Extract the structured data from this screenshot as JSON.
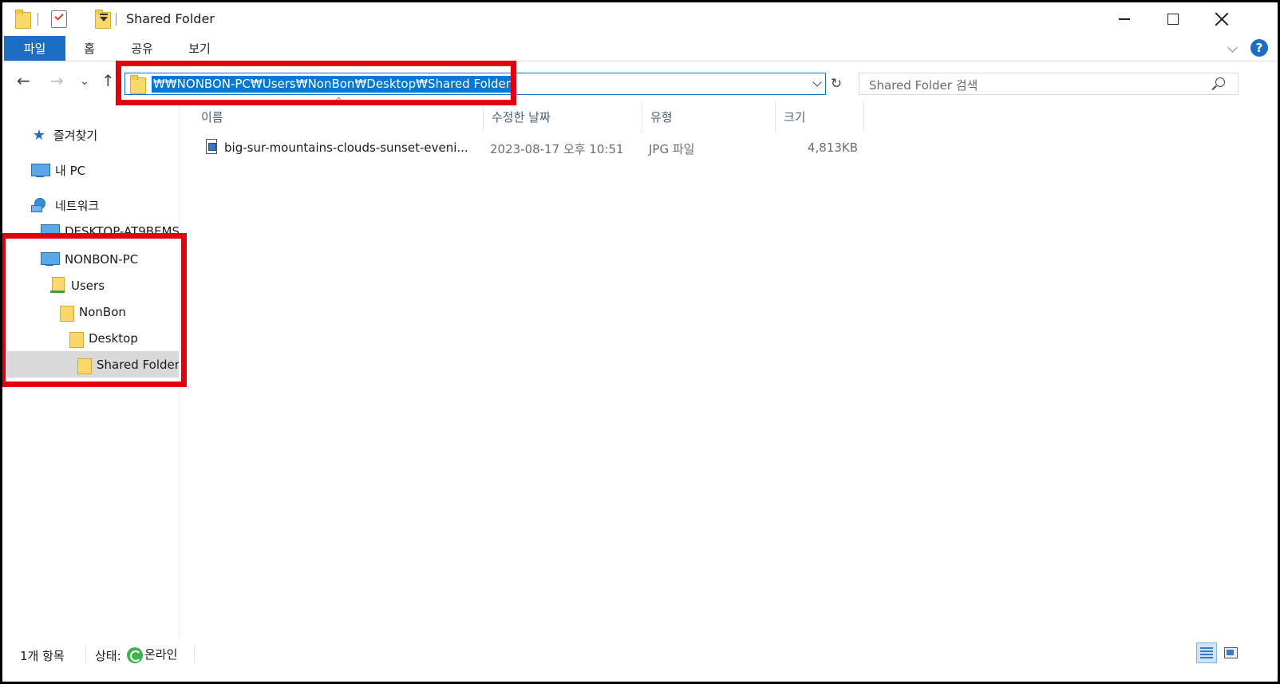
{
  "titlebar": {
    "title": "Shared Folder",
    "icons": [
      "folder-icon",
      "properties-check-icon",
      "new-folder-icon",
      "customize-toolbar-icon"
    ],
    "controls": [
      "minimize",
      "maximize",
      "close"
    ]
  },
  "ribbon": {
    "tabs": [
      "파일",
      "홈",
      "공유",
      "보기"
    ],
    "help": "?"
  },
  "navigation": {
    "back": "←",
    "forward": "→",
    "recent": "⌄",
    "up": "↑",
    "address": "₩₩NONBON-PC₩Users₩NonBon₩Desktop₩Shared Folder",
    "refresh": "↻",
    "search_placeholder": "Shared Folder 검색"
  },
  "sidebar": {
    "items": [
      {
        "label": "즐겨찾기",
        "icon": "star-icon"
      },
      {
        "label": "내 PC",
        "icon": "pc-icon"
      },
      {
        "label": "네트워크",
        "icon": "network-icon"
      },
      {
        "label": "DESKTOP-AT9BEMS",
        "icon": "pc-icon"
      },
      {
        "label": "NONBON-PC",
        "icon": "pc-icon"
      },
      {
        "label": "Users",
        "icon": "shared-folder-icon"
      },
      {
        "label": "NonBon",
        "icon": "folder-icon"
      },
      {
        "label": "Desktop",
        "icon": "folder-icon"
      },
      {
        "label": "Shared Folder",
        "icon": "folder-icon",
        "selected": true
      }
    ]
  },
  "columns": [
    "이름",
    "수정한 날짜",
    "유형",
    "크기"
  ],
  "files": [
    {
      "name": "big-sur-mountains-clouds-sunset-eveni...",
      "modified": "2023-08-17 오후 10:51",
      "type": "JPG 파일",
      "size": "4,813KB",
      "icon": "jpg-file-icon"
    }
  ],
  "status": {
    "count": "1개 항목",
    "state_label": "상태:",
    "state_value": "온라인"
  },
  "colors": {
    "accent": "#1c6ec4",
    "selection": "#0078d7",
    "highlight_box": "#e3000e",
    "folder": "#fbd86b"
  }
}
